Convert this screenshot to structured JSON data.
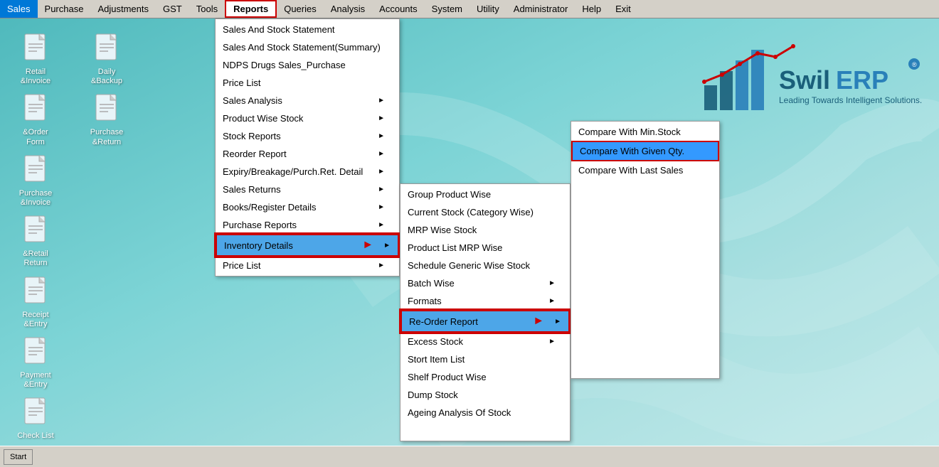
{
  "menubar": {
    "items": [
      {
        "label": "Sales",
        "active": false
      },
      {
        "label": "Purchase",
        "active": false
      },
      {
        "label": "Adjustments",
        "active": false
      },
      {
        "label": "GST",
        "active": false
      },
      {
        "label": "Tools",
        "active": false
      },
      {
        "label": "Reports",
        "active": true
      },
      {
        "label": "Queries",
        "active": false
      },
      {
        "label": "Analysis",
        "active": false
      },
      {
        "label": "Accounts",
        "active": false
      },
      {
        "label": "System",
        "active": false
      },
      {
        "label": "Utility",
        "active": false
      },
      {
        "label": "Administrator",
        "active": false
      },
      {
        "label": "Help",
        "active": false
      },
      {
        "label": "Exit",
        "active": false
      }
    ]
  },
  "desktop_icons": [
    {
      "label": "Retail\n&Invoice",
      "row": 0,
      "col": 0
    },
    {
      "label": "Daily\n&Backup",
      "row": 0,
      "col": 1
    },
    {
      "label": "&Order\nForm",
      "row": 1,
      "col": 0
    },
    {
      "label": "Purchase\n&Return",
      "row": 1,
      "col": 1
    },
    {
      "label": "Purchase\n&Invoice",
      "row": 2,
      "col": 0
    },
    {
      "label": "&Retail\nReturn",
      "row": 3,
      "col": 0
    },
    {
      "label": "Receipt\n&Entry",
      "row": 4,
      "col": 0
    },
    {
      "label": "Payment\n&Entry",
      "row": 5,
      "col": 0
    },
    {
      "label": "Check List",
      "row": 6,
      "col": 0
    }
  ],
  "reports_menu": {
    "items": [
      {
        "label": "Sales And Stock Statement",
        "has_sub": false
      },
      {
        "label": "Sales And Stock Statement(Summary)",
        "has_sub": false
      },
      {
        "label": "NDPS Drugs Sales_Purchase",
        "has_sub": false
      },
      {
        "label": "Price List",
        "has_sub": false
      },
      {
        "label": "Sales Analysis",
        "has_sub": true
      },
      {
        "label": "Product Wise Stock",
        "has_sub": true
      },
      {
        "label": "Stock Reports",
        "has_sub": true
      },
      {
        "label": "Reorder Report",
        "has_sub": true
      },
      {
        "label": "Expiry/Breakage/Purch.Ret. Detail",
        "has_sub": true
      },
      {
        "label": "Sales Returns",
        "has_sub": true
      },
      {
        "label": "Books/Register Details",
        "has_sub": true
      },
      {
        "label": "Purchase Reports",
        "has_sub": true
      },
      {
        "label": "Inventory Details",
        "has_sub": true,
        "highlighted": true
      },
      {
        "label": "Price List",
        "has_sub": true
      }
    ]
  },
  "inventory_submenu": {
    "items": [
      {
        "label": "Group Product Wise",
        "has_sub": false
      },
      {
        "label": "Current Stock (Category Wise)",
        "has_sub": false
      },
      {
        "label": "MRP Wise Stock",
        "has_sub": false
      },
      {
        "label": "Product List MRP Wise",
        "has_sub": false
      },
      {
        "label": "Schedule Generic Wise Stock",
        "has_sub": false
      },
      {
        "label": "Batch Wise",
        "has_sub": true
      },
      {
        "label": "Formats",
        "has_sub": true
      },
      {
        "label": "Re-Order Report",
        "has_sub": true,
        "highlighted": true
      },
      {
        "label": "Excess Stock",
        "has_sub": true
      },
      {
        "label": "Stort Item List",
        "has_sub": false
      },
      {
        "label": "Shelf Product Wise",
        "has_sub": false
      },
      {
        "label": "Dump Stock",
        "has_sub": false
      },
      {
        "label": "Ageing Analysis Of Stock",
        "has_sub": false
      }
    ]
  },
  "reorder_submenu": {
    "items": [
      {
        "label": "Compare With Min.Stock",
        "has_sub": false
      },
      {
        "label": "Compare With Given Qty.",
        "has_sub": false,
        "highlighted": true
      },
      {
        "label": "Compare With Last Sales",
        "has_sub": false
      }
    ]
  },
  "logo": {
    "company": "SwilERP",
    "tagline": "Leading Towards Intelligent Solutions."
  },
  "taskbar": {
    "start_label": "Start"
  }
}
